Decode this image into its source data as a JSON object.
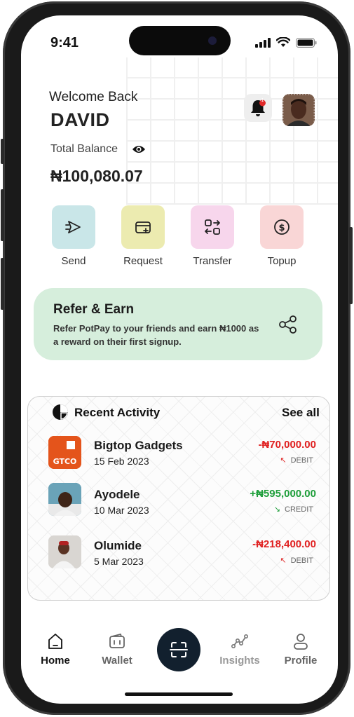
{
  "status_bar": {
    "time": "9:41"
  },
  "header": {
    "welcome": "Welcome Back",
    "name": "DAVID",
    "notification_badge": "1",
    "balance_label": "Total Balance",
    "balance": "₦100,080.07"
  },
  "actions": [
    {
      "label": "Send",
      "color": "#c9e6e8",
      "icon": "send-icon"
    },
    {
      "label": "Request",
      "color": "#ecebb0",
      "icon": "request-icon"
    },
    {
      "label": "Transfer",
      "color": "#f7d6ec",
      "icon": "transfer-icon"
    },
    {
      "label": "Topup",
      "color": "#f9d6d6",
      "icon": "topup-icon"
    }
  ],
  "refer": {
    "title": "Refer & Earn",
    "text": "Refer PotPay to your friends and earn ₦1000 as a reward on their first signup."
  },
  "activity": {
    "title": "Recent Activity",
    "see_all": "See all",
    "transactions": [
      {
        "name": "Bigtop Gadgets",
        "date": "15 Feb 2023",
        "amount": "-₦70,000.00",
        "type": "DEBIT",
        "logo": "GTCO"
      },
      {
        "name": "Ayodele",
        "date": "10 Mar 2023",
        "amount": "+₦595,000.00",
        "type": "CREDIT"
      },
      {
        "name": "Olumide",
        "date": "5 Mar 2023",
        "amount": "-₦218,400.00",
        "type": "DEBIT"
      }
    ]
  },
  "nav": {
    "home": "Home",
    "wallet": "Wallet",
    "insights": "Insights",
    "profile": "Profile"
  },
  "colors": {
    "refer_bg": "#d6eedc",
    "debit": "#e02020",
    "credit": "#1e9e3a",
    "scan_button": "#12202e"
  }
}
